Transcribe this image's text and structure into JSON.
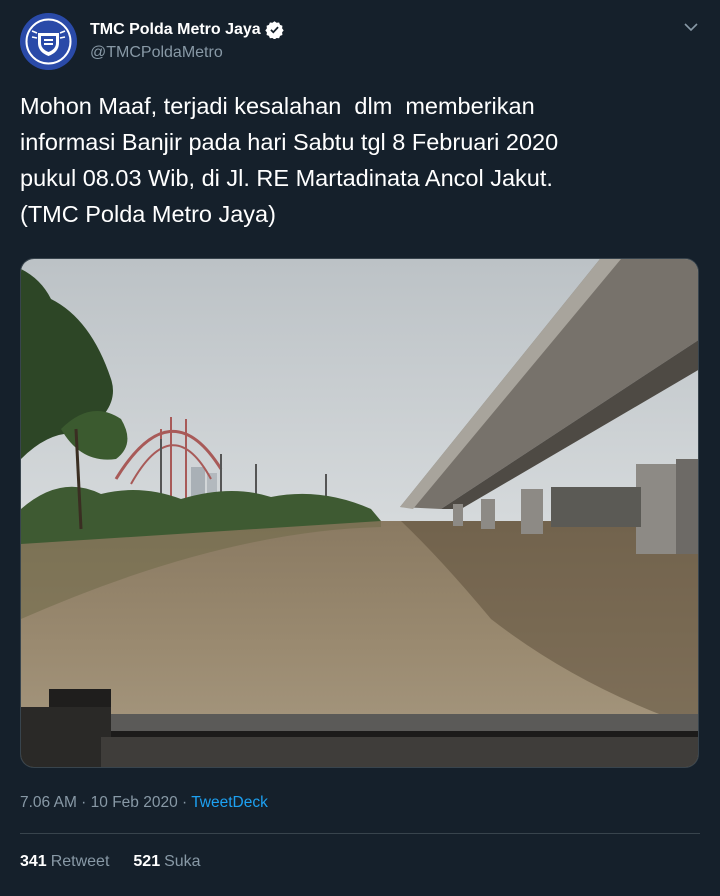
{
  "author": {
    "display_name": "TMC Polda Metro Jaya",
    "handle": "@TMCPoldaMetro",
    "avatar_icon": "police-emblem-avatar",
    "verified_icon": "verified-badge-icon"
  },
  "tweet": {
    "text": "Mohon Maaf, terjadi kesalahan  dlm  memberikan\ninformasi Banjir pada hari Sabtu tgl 8 Februari 2020\npukul 08.03 Wib, di Jl. RE Martadinata Ancol Jakut.\n(TMC Polda Metro Jaya)",
    "timestamp": "7.06 AM · 10 Feb 2020 · ",
    "source": "TweetDeck"
  },
  "stats": {
    "retweets_count": "341",
    "retweets_label": "Retweet",
    "likes_count": "521",
    "likes_label": "Suka"
  },
  "colors": {
    "background": "#15202b",
    "text_secondary": "#8899a6",
    "link": "#1da1f2",
    "border": "#38444d"
  }
}
